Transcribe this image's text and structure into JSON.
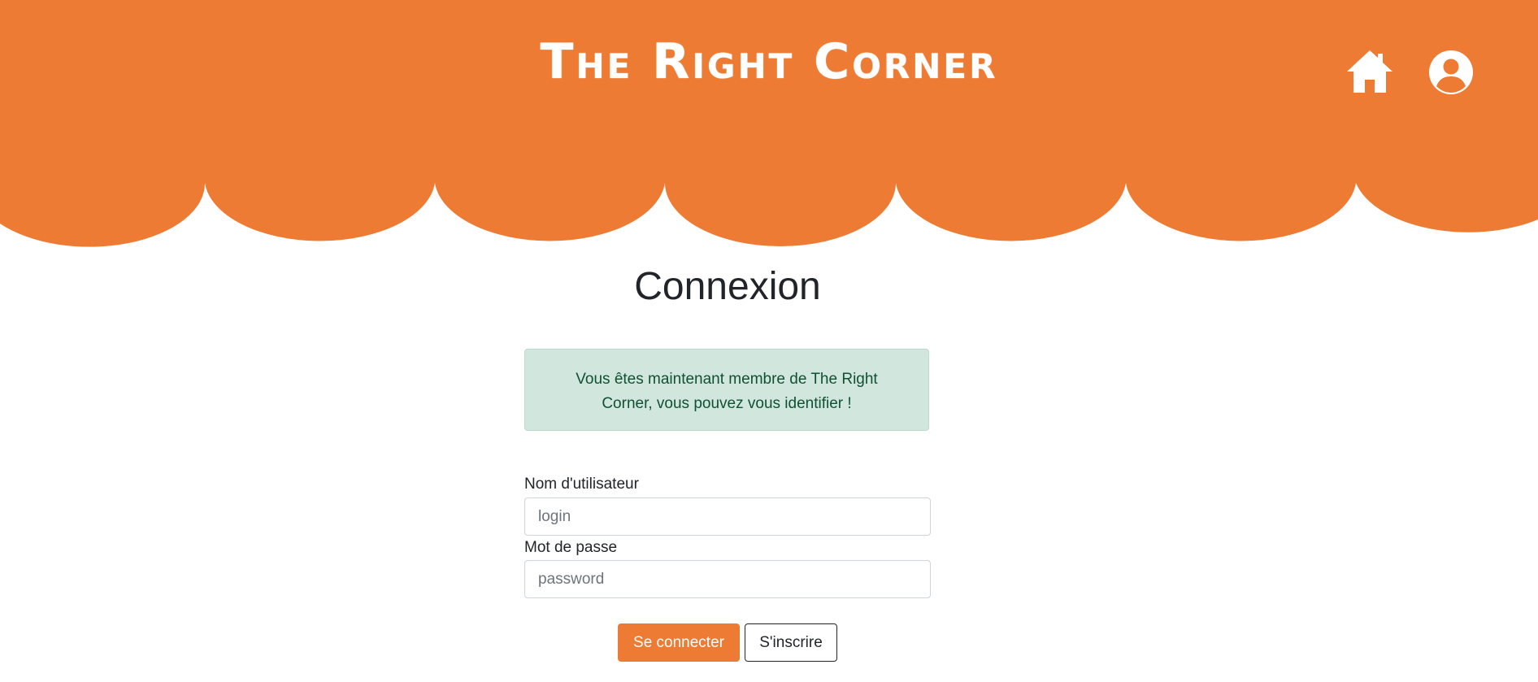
{
  "header": {
    "site_title": "The Right Corner",
    "home_icon": "home-icon",
    "user_icon": "user-account-icon",
    "background_color": "#ed7b33"
  },
  "main": {
    "title": "Connexion",
    "alert": {
      "message": "Vous êtes maintenant membre de The Right Corner, vous pouvez vous identifier !",
      "background_color": "#d1e7dd",
      "text_color": "#0f5132"
    },
    "form": {
      "username_label": "Nom d'utilisateur",
      "username_placeholder": "login",
      "password_label": "Mot de passe",
      "password_placeholder": "password",
      "login_button": "Se connecter",
      "register_button": "S'inscrire"
    }
  }
}
